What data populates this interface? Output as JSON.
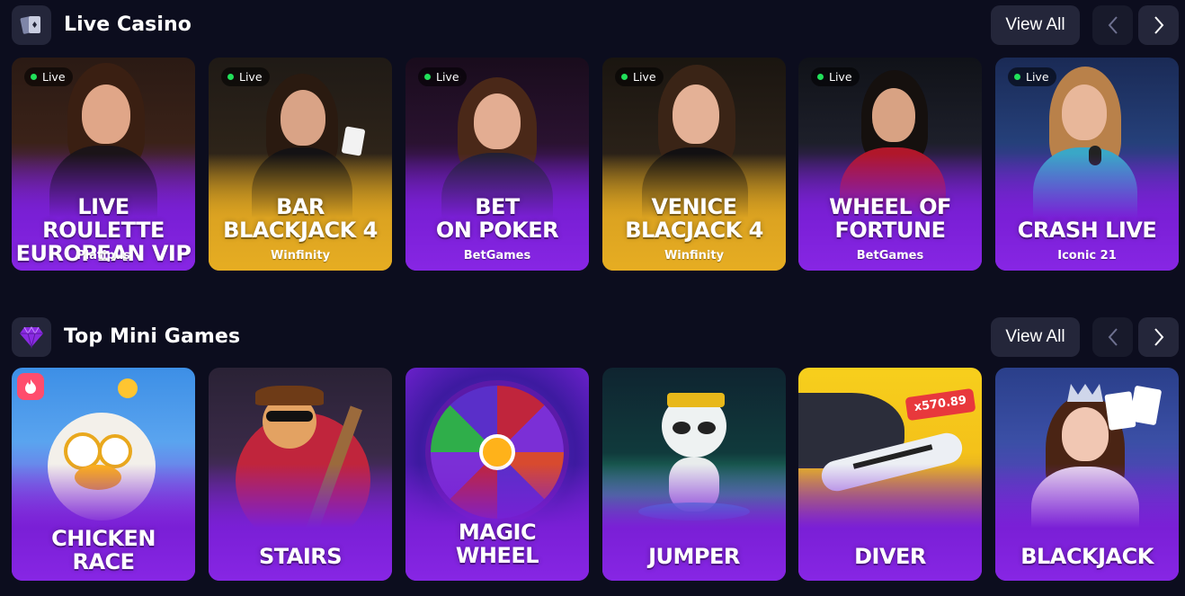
{
  "live_casino": {
    "title": "Live Casino",
    "view_all": "View All",
    "icon": "cards-icon",
    "cards": [
      {
        "badge": "Live",
        "title": "LIVE ROULETTE\nEUROPEAN VIP",
        "provider": "Platipus"
      },
      {
        "badge": "Live",
        "title": "BAR\nBLACKJACK 4",
        "provider": "Winfinity"
      },
      {
        "badge": "Live",
        "title": "BET\nON POKER",
        "provider": "BetGames"
      },
      {
        "badge": "Live",
        "title": "VENICE\nBLACJACK 4",
        "provider": "Winfinity"
      },
      {
        "badge": "Live",
        "title": "WHEEL OF\nFORTUNE",
        "provider": "BetGames"
      },
      {
        "badge": "Live",
        "title": "CRASH LIVE",
        "provider": "Iconic 21"
      }
    ]
  },
  "mini_games": {
    "title": "Top Mini Games",
    "view_all": "View All",
    "icon": "diamond-icon",
    "cards": [
      {
        "title": "CHICKEN\nRACE"
      },
      {
        "title": "STAIRS"
      },
      {
        "title": "MAGIC\nWHEEL"
      },
      {
        "title": "JUMPER"
      },
      {
        "title": "DIVER",
        "multiplier": "x570.89"
      },
      {
        "title": "BLACKJACK"
      }
    ]
  },
  "colors": {
    "background": "#0c0d1e",
    "button": "#24263a",
    "purple_card": "#7a1fd6",
    "gold_card": "#e1a921",
    "live_dot": "#21e05a"
  }
}
